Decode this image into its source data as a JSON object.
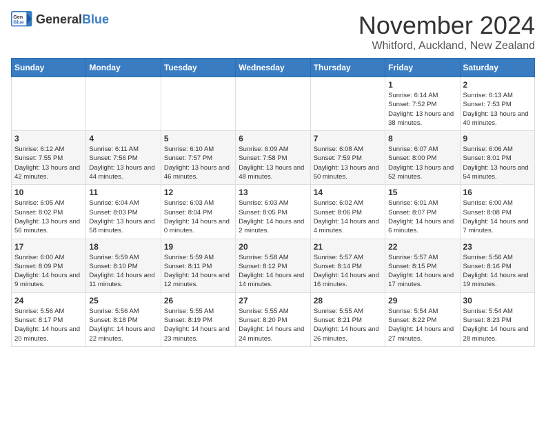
{
  "logo": {
    "general": "General",
    "blue": "Blue"
  },
  "title": "November 2024",
  "location": "Whitford, Auckland, New Zealand",
  "weekdays": [
    "Sunday",
    "Monday",
    "Tuesday",
    "Wednesday",
    "Thursday",
    "Friday",
    "Saturday"
  ],
  "weeks": [
    [
      {
        "day": "",
        "info": ""
      },
      {
        "day": "",
        "info": ""
      },
      {
        "day": "",
        "info": ""
      },
      {
        "day": "",
        "info": ""
      },
      {
        "day": "",
        "info": ""
      },
      {
        "day": "1",
        "info": "Sunrise: 6:14 AM\nSunset: 7:52 PM\nDaylight: 13 hours and 38 minutes."
      },
      {
        "day": "2",
        "info": "Sunrise: 6:13 AM\nSunset: 7:53 PM\nDaylight: 13 hours and 40 minutes."
      }
    ],
    [
      {
        "day": "3",
        "info": "Sunrise: 6:12 AM\nSunset: 7:55 PM\nDaylight: 13 hours and 42 minutes."
      },
      {
        "day": "4",
        "info": "Sunrise: 6:11 AM\nSunset: 7:56 PM\nDaylight: 13 hours and 44 minutes."
      },
      {
        "day": "5",
        "info": "Sunrise: 6:10 AM\nSunset: 7:57 PM\nDaylight: 13 hours and 46 minutes."
      },
      {
        "day": "6",
        "info": "Sunrise: 6:09 AM\nSunset: 7:58 PM\nDaylight: 13 hours and 48 minutes."
      },
      {
        "day": "7",
        "info": "Sunrise: 6:08 AM\nSunset: 7:59 PM\nDaylight: 13 hours and 50 minutes."
      },
      {
        "day": "8",
        "info": "Sunrise: 6:07 AM\nSunset: 8:00 PM\nDaylight: 13 hours and 52 minutes."
      },
      {
        "day": "9",
        "info": "Sunrise: 6:06 AM\nSunset: 8:01 PM\nDaylight: 13 hours and 54 minutes."
      }
    ],
    [
      {
        "day": "10",
        "info": "Sunrise: 6:05 AM\nSunset: 8:02 PM\nDaylight: 13 hours and 56 minutes."
      },
      {
        "day": "11",
        "info": "Sunrise: 6:04 AM\nSunset: 8:03 PM\nDaylight: 13 hours and 58 minutes."
      },
      {
        "day": "12",
        "info": "Sunrise: 6:03 AM\nSunset: 8:04 PM\nDaylight: 14 hours and 0 minutes."
      },
      {
        "day": "13",
        "info": "Sunrise: 6:03 AM\nSunset: 8:05 PM\nDaylight: 14 hours and 2 minutes."
      },
      {
        "day": "14",
        "info": "Sunrise: 6:02 AM\nSunset: 8:06 PM\nDaylight: 14 hours and 4 minutes."
      },
      {
        "day": "15",
        "info": "Sunrise: 6:01 AM\nSunset: 8:07 PM\nDaylight: 14 hours and 6 minutes."
      },
      {
        "day": "16",
        "info": "Sunrise: 6:00 AM\nSunset: 8:08 PM\nDaylight: 14 hours and 7 minutes."
      }
    ],
    [
      {
        "day": "17",
        "info": "Sunrise: 6:00 AM\nSunset: 8:09 PM\nDaylight: 14 hours and 9 minutes."
      },
      {
        "day": "18",
        "info": "Sunrise: 5:59 AM\nSunset: 8:10 PM\nDaylight: 14 hours and 11 minutes."
      },
      {
        "day": "19",
        "info": "Sunrise: 5:59 AM\nSunset: 8:11 PM\nDaylight: 14 hours and 12 minutes."
      },
      {
        "day": "20",
        "info": "Sunrise: 5:58 AM\nSunset: 8:12 PM\nDaylight: 14 hours and 14 minutes."
      },
      {
        "day": "21",
        "info": "Sunrise: 5:57 AM\nSunset: 8:14 PM\nDaylight: 14 hours and 16 minutes."
      },
      {
        "day": "22",
        "info": "Sunrise: 5:57 AM\nSunset: 8:15 PM\nDaylight: 14 hours and 17 minutes."
      },
      {
        "day": "23",
        "info": "Sunrise: 5:56 AM\nSunset: 8:16 PM\nDaylight: 14 hours and 19 minutes."
      }
    ],
    [
      {
        "day": "24",
        "info": "Sunrise: 5:56 AM\nSunset: 8:17 PM\nDaylight: 14 hours and 20 minutes."
      },
      {
        "day": "25",
        "info": "Sunrise: 5:56 AM\nSunset: 8:18 PM\nDaylight: 14 hours and 22 minutes."
      },
      {
        "day": "26",
        "info": "Sunrise: 5:55 AM\nSunset: 8:19 PM\nDaylight: 14 hours and 23 minutes."
      },
      {
        "day": "27",
        "info": "Sunrise: 5:55 AM\nSunset: 8:20 PM\nDaylight: 14 hours and 24 minutes."
      },
      {
        "day": "28",
        "info": "Sunrise: 5:55 AM\nSunset: 8:21 PM\nDaylight: 14 hours and 26 minutes."
      },
      {
        "day": "29",
        "info": "Sunrise: 5:54 AM\nSunset: 8:22 PM\nDaylight: 14 hours and 27 minutes."
      },
      {
        "day": "30",
        "info": "Sunrise: 5:54 AM\nSunset: 8:23 PM\nDaylight: 14 hours and 28 minutes."
      }
    ]
  ]
}
